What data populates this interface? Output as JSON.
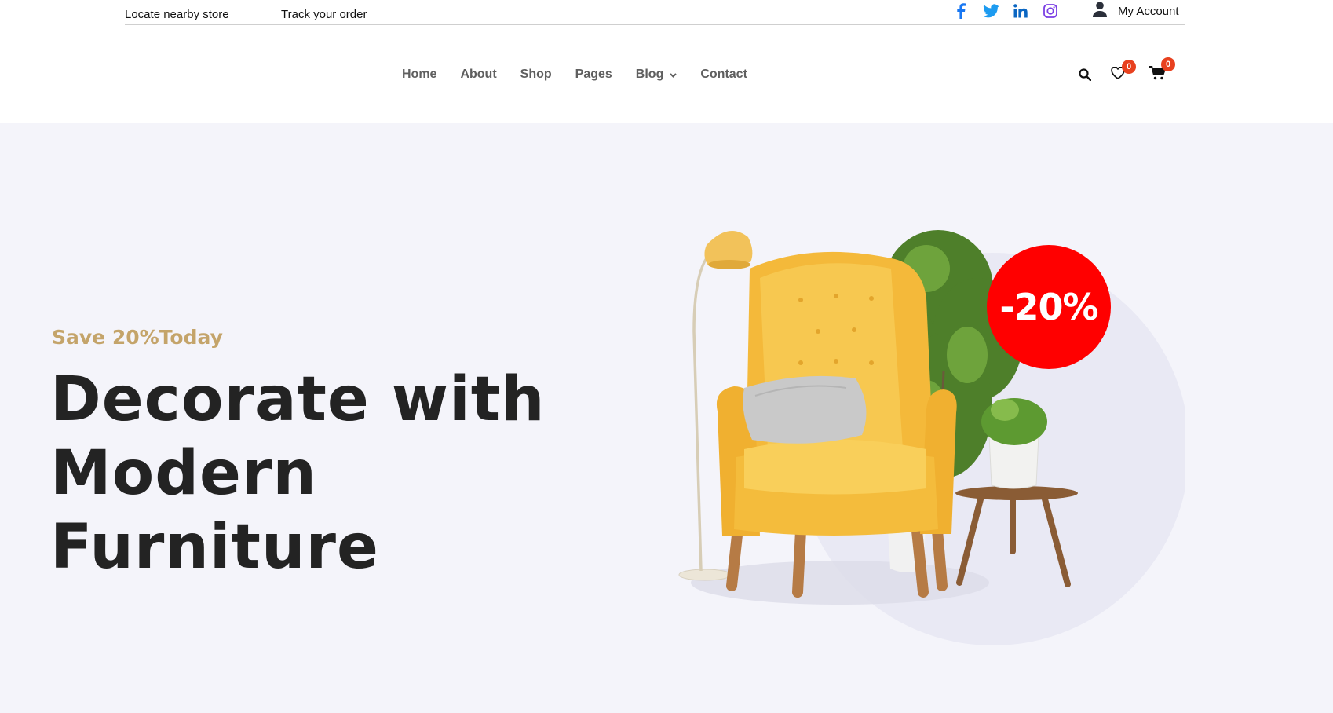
{
  "topbar": {
    "locate_store": "Locate nearby store",
    "track_order": "Track your order",
    "account_label": "My Account",
    "social": [
      {
        "icon": "facebook-icon",
        "color": "#1877f2"
      },
      {
        "icon": "twitter-icon",
        "color": "#1d9bf0"
      },
      {
        "icon": "linkedin-icon",
        "color": "#0a66c2"
      },
      {
        "icon": "instagram-icon",
        "color": "#7b3fe4"
      }
    ]
  },
  "nav": {
    "items": [
      {
        "label": "Home"
      },
      {
        "label": "About"
      },
      {
        "label": "Shop"
      },
      {
        "label": "Pages"
      },
      {
        "label": "Blog",
        "has_dropdown": true
      },
      {
        "label": "Contact"
      }
    ]
  },
  "header_icons": {
    "wishlist_count": "0",
    "cart_count": "0",
    "badge_color": "#e8411f"
  },
  "hero": {
    "eyebrow": "Save 20%Today",
    "headline_lines": [
      "Decorate with",
      "Modern",
      "Furniture"
    ],
    "discount_badge": "-20%",
    "background": "#f4f4fa",
    "accent": "#c4a46a"
  }
}
